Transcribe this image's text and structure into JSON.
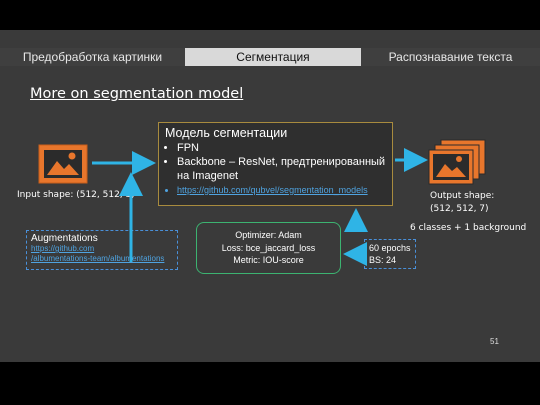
{
  "tabs": [
    {
      "label": "Предобработка картинки",
      "active": false
    },
    {
      "label": "Сегментация",
      "active": true
    },
    {
      "label": "Распознавание текста",
      "active": false
    }
  ],
  "heading": "More on segmentation model",
  "input": {
    "label": "Input shape: (512, 512, 3)",
    "icon": "image-icon"
  },
  "output": {
    "label_line1": "Output shape:",
    "label_line2": "(512, 512, 7)",
    "classes": "6 classes + 1 background",
    "icon": "image-stack-icon"
  },
  "model": {
    "title": "Модель сегментации",
    "items": [
      "FPN",
      "Backbone – ResNet, предтренированный на Imagenet"
    ],
    "link": "https://github.com/qubvel/segmentation_models"
  },
  "optimizer": {
    "line1": "Optimizer: Adam",
    "line2": "Loss: bce_jaccard_loss",
    "line3": "Metric: IOU-score"
  },
  "augmentations": {
    "title": "Augmentations",
    "link1": "https://github.com",
    "link2": "/albumentations-team/albumentations"
  },
  "training": {
    "line1": "60 epochs",
    "line2": "BS: 24"
  },
  "page_number": "51",
  "colors": {
    "accent_orange": "#e8762c",
    "arrow_cyan": "#2fb4e6",
    "box_green": "#3cb371",
    "link_blue": "#4fa3e0"
  }
}
